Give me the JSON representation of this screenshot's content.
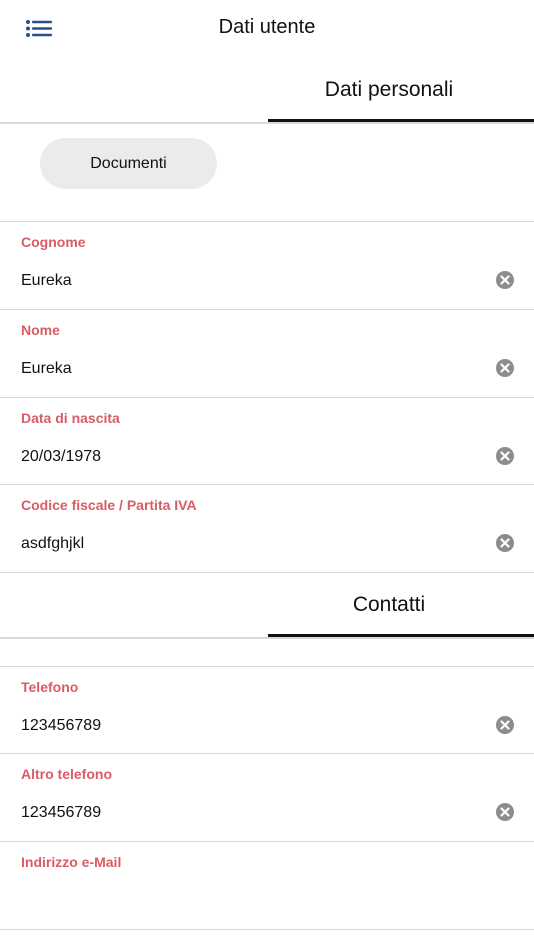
{
  "header": {
    "title": "Dati utente",
    "menu_icon": "list-menu-icon",
    "accent": "#2a4f8c"
  },
  "sections": [
    {
      "label": "Dati personali"
    },
    {
      "label": "Contatti"
    }
  ],
  "documents_button": {
    "label": "Documenti"
  },
  "personal_fields": [
    {
      "label": "Cognome",
      "value": "Eureka"
    },
    {
      "label": "Nome",
      "value": "Eureka"
    },
    {
      "label": "Data di nascita",
      "value": "20/03/1978"
    },
    {
      "label": "Codice fiscale / Partita IVA",
      "value": "asdfghjkl"
    }
  ],
  "contact_fields": [
    {
      "label": "Telefono",
      "value": "123456789"
    },
    {
      "label": "Altro telefono",
      "value": "123456789"
    },
    {
      "label": "Indirizzo e-Mail",
      "value": ""
    }
  ],
  "colors": {
    "label": "#d95c66",
    "divider": "#d6d6d6",
    "pill": "#ebebeb",
    "clear_icon": "#8c8c8c"
  }
}
